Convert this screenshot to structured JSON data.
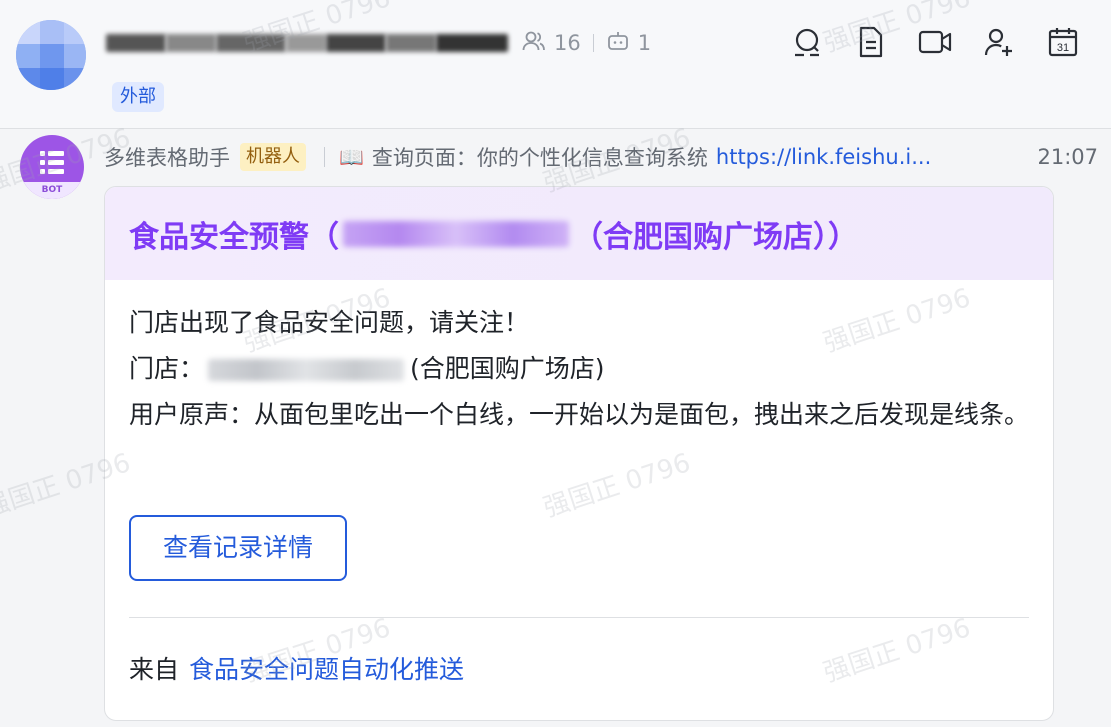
{
  "header": {
    "member_count": "16",
    "bot_count": "1",
    "external_tag": "外部",
    "tools": [
      "search-icon",
      "doc-icon",
      "video-icon",
      "add-member-icon",
      "calendar-icon"
    ],
    "calendar_day": "31"
  },
  "message": {
    "sender": "多维表格助手",
    "sender_tag": "机器人",
    "topic_icon": "📖",
    "topic": "查询页面：你的个性化信息查询系统",
    "link": "https://link.feishu.i...",
    "time": "21:07",
    "bot_avatar_label": "BOT"
  },
  "card": {
    "title_prefix": "食品安全预警（",
    "title_suffix": "（合肥国购广场店））",
    "line1": "门店出现了食品安全问题，请关注！",
    "store_label": "门店：",
    "store_suffix": "(合肥国购广场店)",
    "feedback": "用户原声：从面包里吃出一个白线，一开始以为是面包，拽出来之后发现是线条。",
    "button": "查看记录详情",
    "footer_from": "来自",
    "footer_source": "食品安全问题自动化推送"
  },
  "watermark_text": "强国正 0796"
}
